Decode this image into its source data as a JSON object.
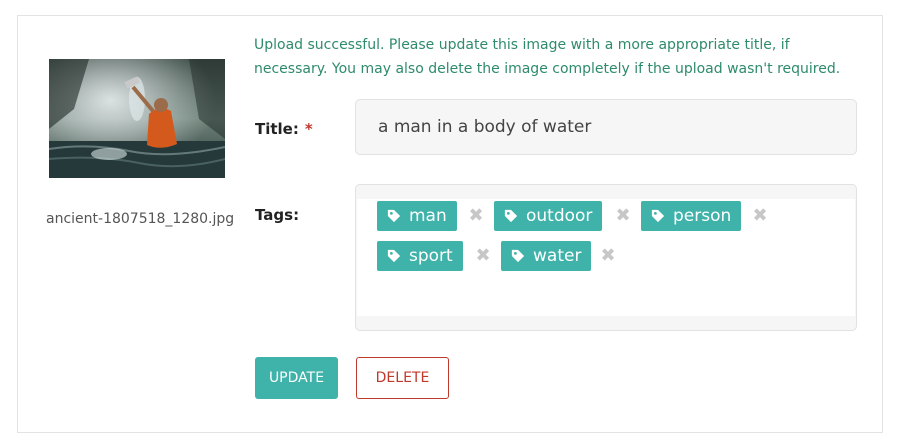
{
  "image": {
    "filename": "ancient-1807518_1280.jpg",
    "alt": "a man in a body of water"
  },
  "message": "Upload successful. Please update this image with a more appropriate title, if necessary. You may also delete the image completely if the upload wasn't required.",
  "form": {
    "title_label": "Title:",
    "required_mark": "*",
    "title_value": "a man in a body of water",
    "tags_label": "Tags:",
    "tags": [
      "man",
      "outdoor",
      "person",
      "sport",
      "water"
    ],
    "remove_symbol": "✖"
  },
  "actions": {
    "update_label": "UPDATE",
    "delete_label": "DELETE"
  },
  "colors": {
    "accent": "#3fb2aa",
    "success_text": "#2e8b6b",
    "danger": "#c0392b"
  },
  "icons": {
    "tag": "tag-icon",
    "remove": "close-icon"
  }
}
